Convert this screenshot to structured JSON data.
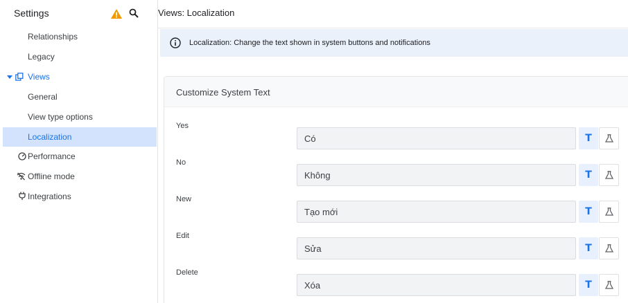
{
  "sidebar": {
    "title": "Settings",
    "items": [
      {
        "label": "Relationships"
      },
      {
        "label": "Legacy"
      },
      {
        "label": "Views"
      },
      {
        "label": "General"
      },
      {
        "label": "View type options"
      },
      {
        "label": "Localization"
      },
      {
        "label": "Performance"
      },
      {
        "label": "Offline mode"
      },
      {
        "label": "Integrations"
      }
    ]
  },
  "main": {
    "title": "Views: Localization",
    "banner": "Localization: Change the text shown in system buttons and notifications",
    "card_title": "Customize System Text",
    "rows": [
      {
        "label": "Yes",
        "value": "Có"
      },
      {
        "label": "No",
        "value": "Không"
      },
      {
        "label": "New",
        "value": "Tạo mới"
      },
      {
        "label": "Edit",
        "value": "Sửa"
      },
      {
        "label": "Delete",
        "value": "Xóa"
      }
    ],
    "text_button_label": "T"
  },
  "colors": {
    "accent": "#1a73e8",
    "active_bg": "#d3e3fd",
    "banner_bg": "#eaf1fb",
    "warning": "#f29900"
  }
}
